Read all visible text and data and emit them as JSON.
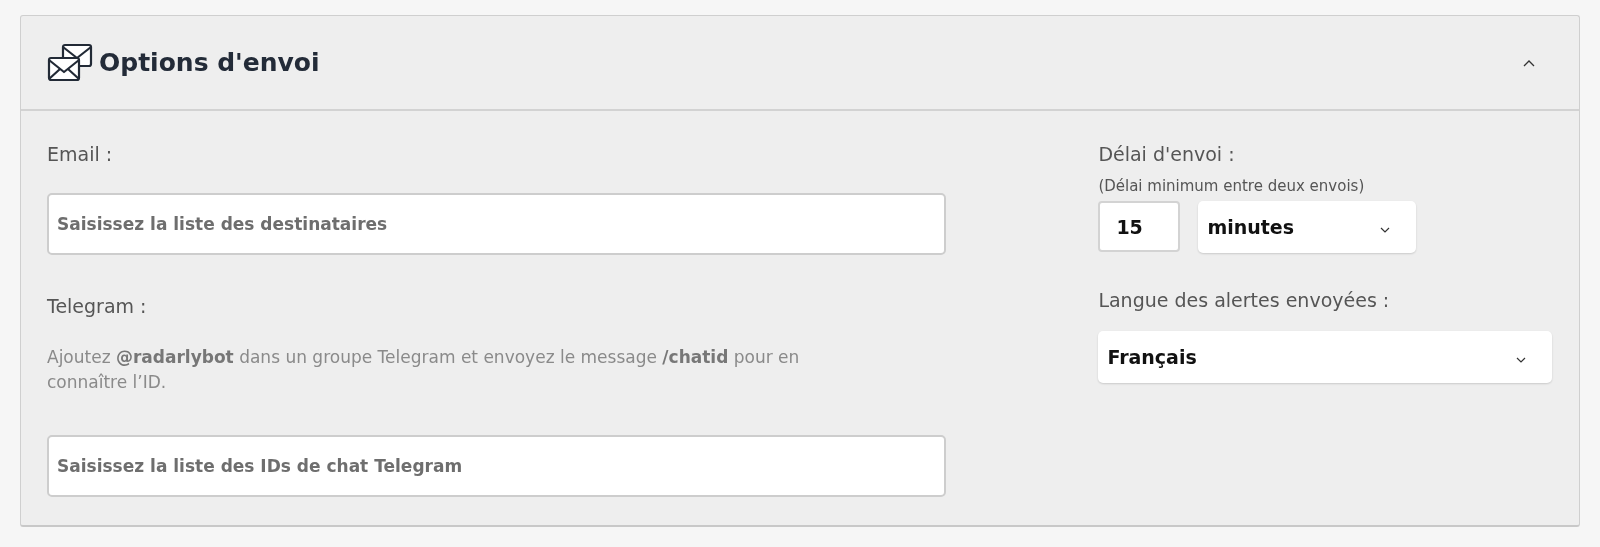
{
  "panel": {
    "title": "Options d'envoi",
    "expanded": true
  },
  "email": {
    "label": "Email :",
    "placeholder": "Saisissez la liste des destinataires"
  },
  "telegram": {
    "label": "Telegram :",
    "help": "Ajoutez **@radarlybot** dans un groupe Telegram et envoyez le message **/chatid** pour en connaître l’ID.",
    "placeholder": "Saisissez la liste des IDs de chat Telegram"
  },
  "delay": {
    "label": "Délai d'envoi :",
    "hint": "(Délai minimum entre deux envois)",
    "value": "15",
    "unit": "minutes"
  },
  "language": {
    "label": "Langue des alertes envoyées :",
    "value": "Français"
  }
}
